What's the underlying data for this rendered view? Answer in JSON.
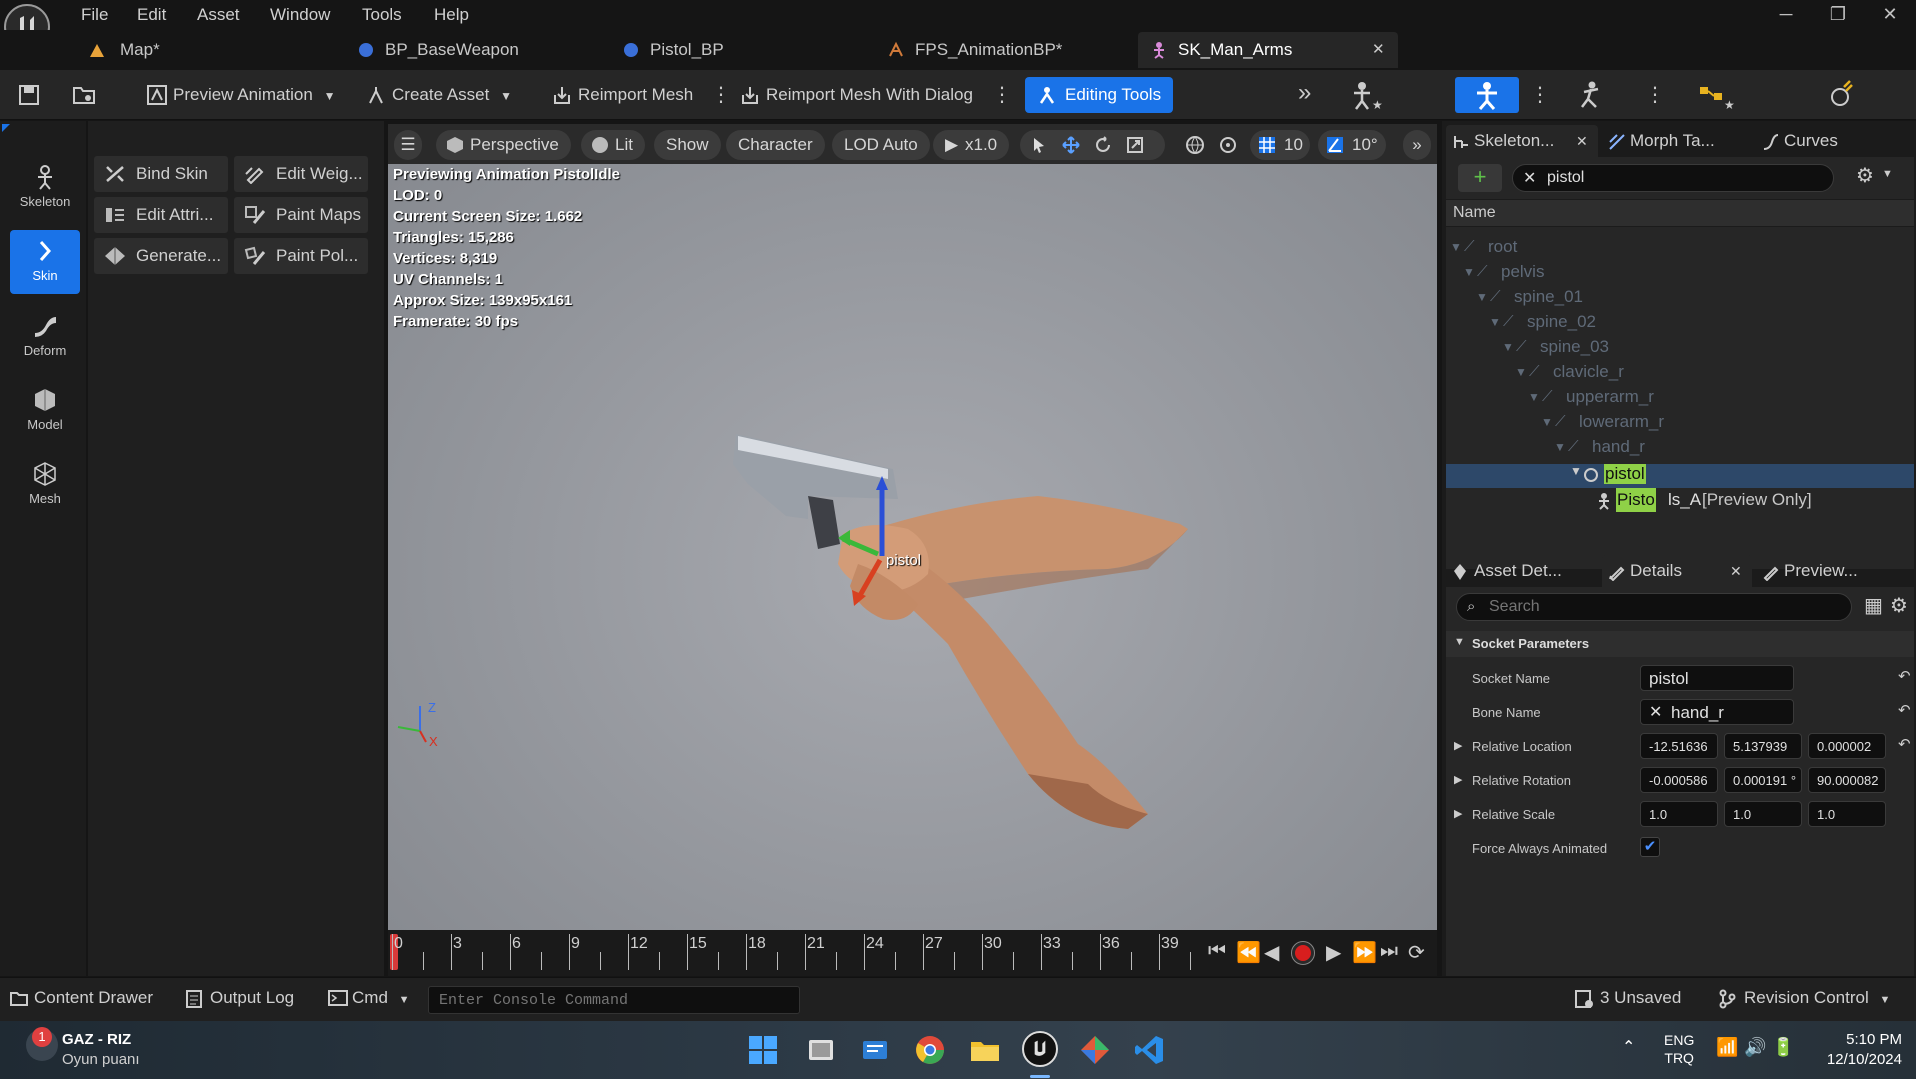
{
  "menu": {
    "items": [
      "File",
      "Edit",
      "Asset",
      "Window",
      "Tools",
      "Help"
    ]
  },
  "tabs": [
    {
      "label": "Map*"
    },
    {
      "label": "BP_BaseWeapon"
    },
    {
      "label": "Pistol_BP"
    },
    {
      "label": "FPS_AnimationBP*"
    },
    {
      "label": "SK_Man_Arms"
    }
  ],
  "toolbar": {
    "preview_animation": "Preview Animation",
    "create_asset": "Create Asset",
    "reimport_mesh": "Reimport Mesh",
    "reimport_dialog": "Reimport Mesh With Dialog",
    "editing_tools": "Editing Tools"
  },
  "modes": [
    {
      "label": "Skeleton"
    },
    {
      "label": "Skin"
    },
    {
      "label": "Deform"
    },
    {
      "label": "Model"
    },
    {
      "label": "Mesh"
    }
  ],
  "palette": {
    "bind_skin": "Bind Skin",
    "edit_weights": "Edit Weig...",
    "edit_attributes": "Edit Attri...",
    "paint_maps": "Paint Maps",
    "generate": "Generate...",
    "paint_poly": "Paint Pol..."
  },
  "viewport": {
    "perspective": "Perspective",
    "lit": "Lit",
    "show": "Show",
    "character": "Character",
    "lod": "LOD Auto",
    "speed": "x1.0",
    "grid_size": "10",
    "angle_snap": "10°",
    "stats": [
      "Previewing Animation PistolIdle",
      "LOD: 0",
      "Current Screen Size: 1.662",
      "Triangles: 15,286",
      "Vertices: 8,319",
      "UV Channels: 1",
      "Approx Size: 139x95x161",
      "Framerate: 30 fps"
    ],
    "socket_label": "pistol",
    "axis_z": "Z",
    "axis_x": "X"
  },
  "timeline": {
    "ticks": [
      "0",
      "3",
      "6",
      "9",
      "12",
      "15",
      "18",
      "21",
      "24",
      "27",
      "30",
      "33",
      "36",
      "39"
    ]
  },
  "right_tabs": {
    "skeleton": "Skeleton...",
    "morph": "Morph Ta...",
    "curves": "Curves"
  },
  "tree": {
    "search_value": "pistol",
    "header": "Name",
    "bones": [
      "root",
      "pelvis",
      "spine_01",
      "spine_02",
      "spine_03",
      "clavicle_r",
      "upperarm_r",
      "lowerarm_r",
      "hand_r"
    ],
    "socket_match": "pistol",
    "mesh_prefix": "Pisto",
    "mesh_rest": "ls_A",
    "mesh_suffix": "[Preview Only]"
  },
  "details_tabs": {
    "asset": "Asset Det...",
    "details": "Details",
    "preview": "Preview..."
  },
  "details": {
    "search_placeholder": "Search",
    "section": "Socket Parameters",
    "socket_name_label": "Socket Name",
    "socket_name": "pistol",
    "bone_name_label": "Bone Name",
    "bone_name": "hand_r",
    "rel_loc_label": "Relative Location",
    "rel_loc": [
      "-12.51636",
      "5.137939",
      "0.000002"
    ],
    "rel_rot_label": "Relative Rotation",
    "rel_rot": [
      "-0.000586",
      "0.000191 °",
      "90.000082"
    ],
    "rel_scale_label": "Relative Scale",
    "rel_scale": [
      "1.0",
      "1.0",
      "1.0"
    ],
    "force_label": "Force Always Animated",
    "force_checked": true
  },
  "statusbar": {
    "content_drawer": "Content Drawer",
    "output_log": "Output Log",
    "cmd": "Cmd",
    "console_placeholder": "Enter Console Command",
    "unsaved": "3 Unsaved",
    "revision": "Revision Control"
  },
  "taskbar": {
    "notif_count": "1",
    "media_title": "GAZ - RIZ",
    "media_sub": "Oyun puanı",
    "lang1": "ENG",
    "lang2": "TRQ",
    "time": "5:10 PM",
    "date": "12/10/2024"
  },
  "colors": {
    "accent": "#1a73e8",
    "highlight": "#8fd147",
    "selected_row": "#2d4869"
  }
}
